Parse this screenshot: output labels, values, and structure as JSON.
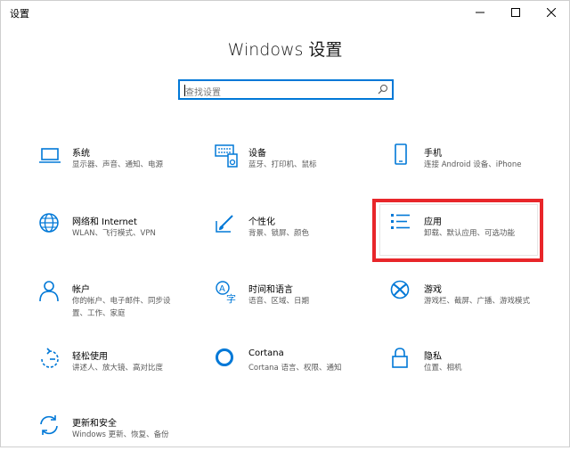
{
  "window": {
    "title": "设置",
    "minimize_icon": "minimize-icon",
    "maximize_icon": "maximize-icon",
    "close_icon": "close-icon"
  },
  "heading": "Windows 设置",
  "search": {
    "placeholder": "查找设置",
    "icon": "search-icon"
  },
  "tiles": [
    {
      "name": "系统",
      "desc": "显示器、声音、通知、电源",
      "icon": "laptop-icon"
    },
    {
      "name": "设备",
      "desc": "蓝牙、打印机、鼠标",
      "icon": "keyboard-speaker-icon"
    },
    {
      "name": "手机",
      "desc": "连接 Android 设备、iPhone",
      "icon": "phone-icon"
    },
    {
      "name": "网络和 Internet",
      "desc": "WLAN、飞行模式、VPN",
      "icon": "globe-icon"
    },
    {
      "name": "个性化",
      "desc": "背景、锁屏、颜色",
      "icon": "paint-brush-icon"
    },
    {
      "name": "应用",
      "desc": "卸载、默认应用、可选功能",
      "icon": "apps-list-icon"
    },
    {
      "name": "帐户",
      "desc1": "你的帐户、电子邮件、同步设",
      "desc2": "置、工作、家庭",
      "icon": "person-icon"
    },
    {
      "name": "时间和语言",
      "desc": "语音、区域、日期",
      "icon": "time-language-icon"
    },
    {
      "name": "游戏",
      "desc": "游戏栏、截屏、广播、游戏模式",
      "icon": "xbox-icon"
    },
    {
      "name": "轻松使用",
      "desc": "讲述人、放大镜、高对比度",
      "icon": "ease-of-access-icon"
    },
    {
      "name": "Cortana",
      "desc": "Cortana 语言、权限、通知",
      "icon": "cortana-icon"
    },
    {
      "name": "隐私",
      "desc": "位置、相机",
      "icon": "lock-icon"
    },
    {
      "name": "更新和安全",
      "desc": "Windows 更新、恢复、备份",
      "icon": "update-icon"
    }
  ],
  "colors": {
    "accent": "#0078d7",
    "highlight": "#e8262a"
  }
}
